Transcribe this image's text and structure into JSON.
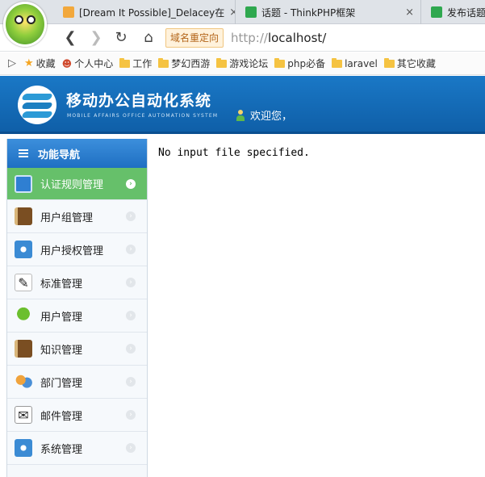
{
  "browser": {
    "tabs": [
      {
        "title": "[Dream It Possible]_Delacey在",
        "close": "×"
      },
      {
        "title": "话题 - ThinkPHP框架",
        "close": "×"
      },
      {
        "title": "发布话题",
        "close": ""
      }
    ],
    "nav": {
      "back": "❮",
      "forward": "❯",
      "reload": "↻",
      "home": "⌂"
    },
    "redirect_label": "域名重定向",
    "url_scheme": "http://",
    "url_host": "localhost/",
    "bookmarks_toggle": "▷",
    "bookmarks": [
      {
        "label": "收藏",
        "kind": "star"
      },
      {
        "label": "个人中心",
        "kind": "person"
      },
      {
        "label": "工作",
        "kind": "folder"
      },
      {
        "label": "梦幻西游",
        "kind": "folder"
      },
      {
        "label": "游戏论坛",
        "kind": "folder"
      },
      {
        "label": "php必备",
        "kind": "folder"
      },
      {
        "label": "laravel",
        "kind": "folder"
      },
      {
        "label": "其它收藏",
        "kind": "folder"
      }
    ]
  },
  "header": {
    "title": "移动办公自动化系统",
    "subtitle": "MOBILE AFFAIRS OFFICE AUTOMATION SYSTEM",
    "welcome": "欢迎您，"
  },
  "sidebar": {
    "heading": "功能导航",
    "items": [
      {
        "label": "认证规则管理",
        "icon": "monitor-icon",
        "active": true
      },
      {
        "label": "用户组管理",
        "icon": "book-icon",
        "active": false
      },
      {
        "label": "用户授权管理",
        "icon": "gear-icon",
        "active": false
      },
      {
        "label": "标准管理",
        "icon": "pencil-icon",
        "active": false
      },
      {
        "label": "用户管理",
        "icon": "tree-icon",
        "active": false
      },
      {
        "label": "知识管理",
        "icon": "book-icon",
        "active": false
      },
      {
        "label": "部门管理",
        "icon": "people-icon",
        "active": false
      },
      {
        "label": "邮件管理",
        "icon": "mail-icon",
        "active": false
      },
      {
        "label": "系统管理",
        "icon": "gear-icon",
        "active": false
      }
    ]
  },
  "main": {
    "message": "No input file specified."
  },
  "colors": {
    "header_blue": "#1a78c6",
    "active_green": "#66c06a",
    "sidebar_head_blue": "#2b7fd0"
  }
}
